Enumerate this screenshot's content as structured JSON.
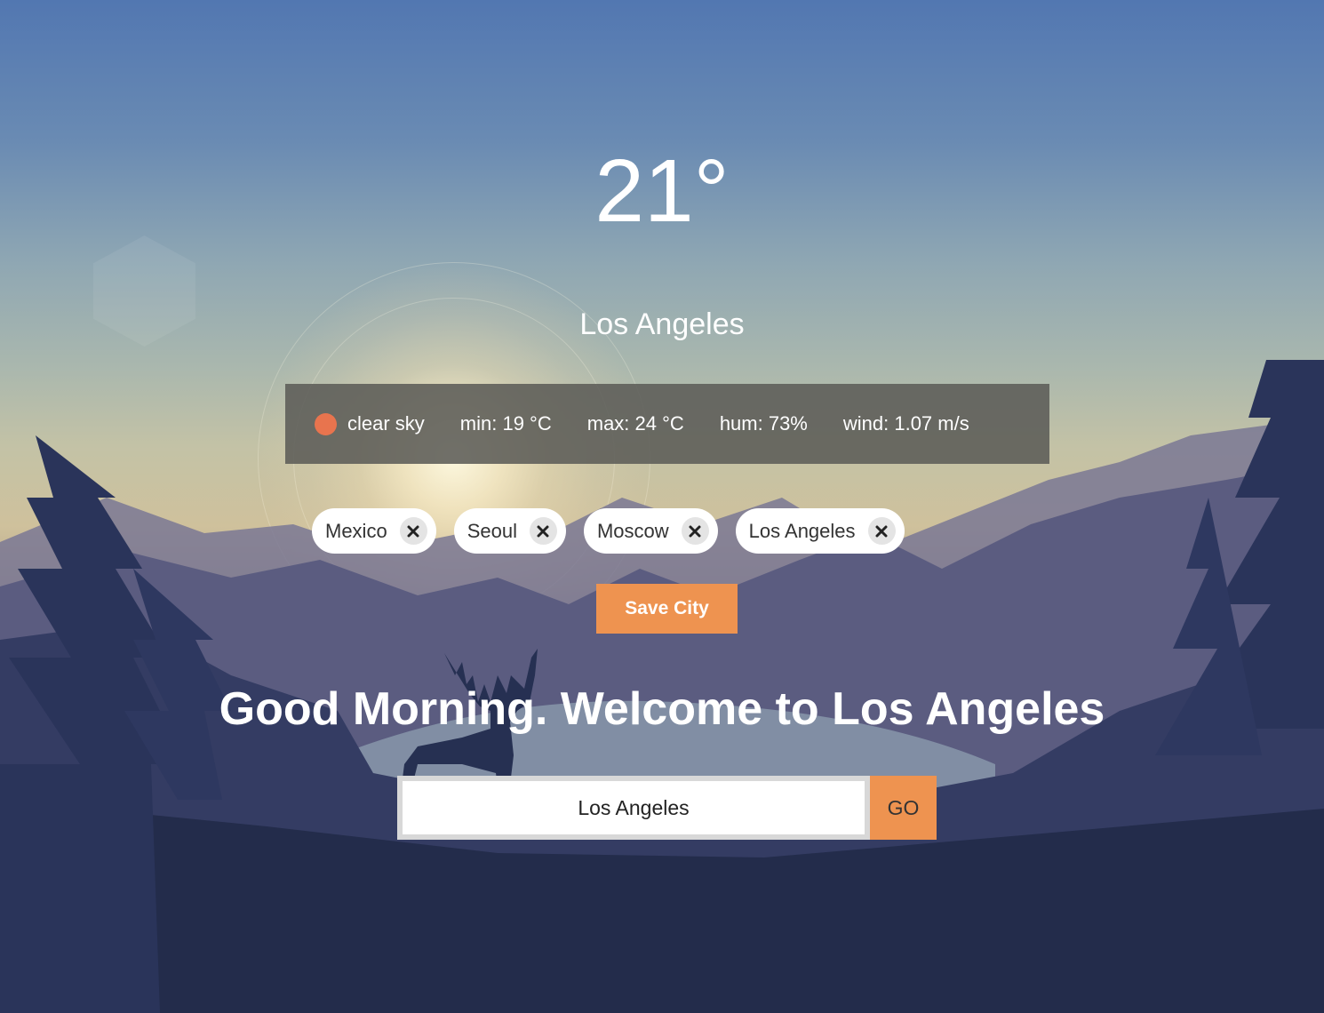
{
  "weather": {
    "temperature": "21°",
    "city": "Los Angeles",
    "description": "clear sky",
    "min": "min: 19 °C",
    "max": "max: 24 °C",
    "humidity": "hum: 73%",
    "wind": "wind: 1.07 m/s",
    "status_icon": "sun-status-dot",
    "status_color": "#e8744e"
  },
  "saved_cities": [
    {
      "label": "Mexico",
      "remove_icon": "close-icon"
    },
    {
      "label": "Seoul",
      "remove_icon": "close-icon"
    },
    {
      "label": "Moscow",
      "remove_icon": "close-icon"
    },
    {
      "label": "Los Angeles",
      "remove_icon": "close-icon"
    }
  ],
  "actions": {
    "save_label": "Save City",
    "go_label": "GO"
  },
  "greeting": "Good Morning. Welcome to Los Angeles",
  "search": {
    "value": "Los Angeles",
    "placeholder": ""
  },
  "colors": {
    "accent": "#ee9350",
    "info_bar": "#5c5c58"
  }
}
